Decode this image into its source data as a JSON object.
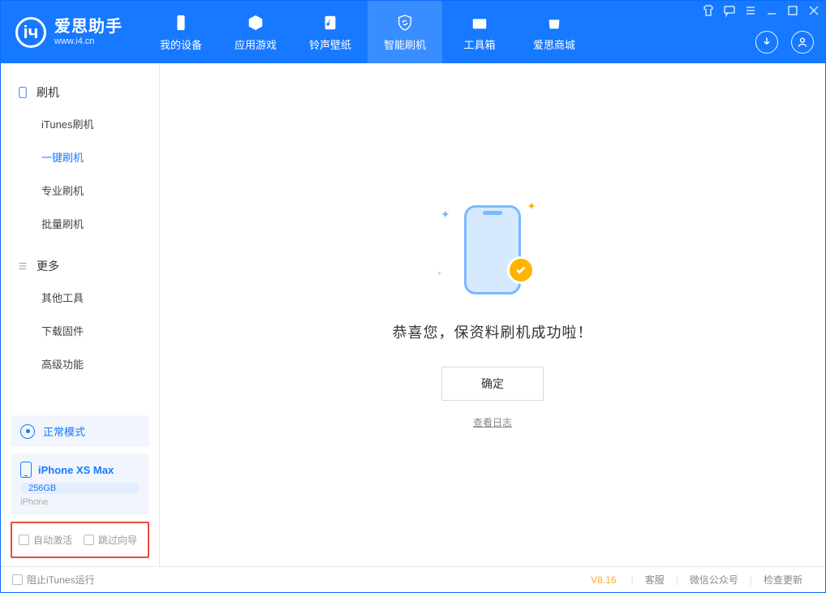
{
  "app": {
    "title": "爱思助手",
    "subtitle": "www.i4.cn"
  },
  "nav": {
    "tabs": [
      {
        "label": "我的设备"
      },
      {
        "label": "应用游戏"
      },
      {
        "label": "铃声壁纸"
      },
      {
        "label": "智能刷机"
      },
      {
        "label": "工具箱"
      },
      {
        "label": "爱思商城"
      }
    ]
  },
  "sidebar": {
    "group1": {
      "title": "刷机",
      "items": [
        {
          "label": "iTunes刷机"
        },
        {
          "label": "一键刷机"
        },
        {
          "label": "专业刷机"
        },
        {
          "label": "批量刷机"
        }
      ]
    },
    "group2": {
      "title": "更多",
      "items": [
        {
          "label": "其他工具"
        },
        {
          "label": "下载固件"
        },
        {
          "label": "高级功能"
        }
      ]
    },
    "mode": "正常模式",
    "device": {
      "name": "iPhone XS Max",
      "storage": "256GB",
      "type": "iPhone"
    },
    "checks": {
      "auto_activate": "自动激活",
      "skip_guide": "跳过向导"
    }
  },
  "main": {
    "success_text": "恭喜您，保资料刷机成功啦！",
    "ok_button": "确定",
    "log_link": "查看日志"
  },
  "footer": {
    "block_itunes": "阻止iTunes运行",
    "version": "V8.16",
    "links": {
      "support": "客服",
      "wechat": "微信公众号",
      "update": "检查更新"
    }
  }
}
